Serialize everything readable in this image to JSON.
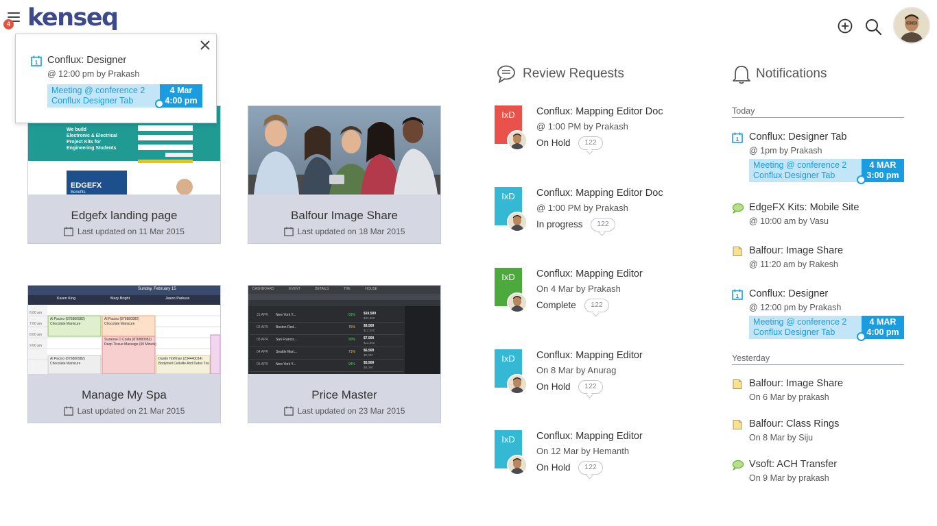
{
  "header": {
    "logo_text": "kenseq",
    "menu_badge": "4",
    "icons": [
      "add-icon",
      "search-icon"
    ]
  },
  "popup": {
    "title": "Conflux: Designer",
    "subtitle": "@ 12:00 pm by Prakash",
    "meeting_line1": "Meeting @ conference 2",
    "meeting_line2": "Conflux Designer Tab",
    "date": "4 Mar",
    "time": "4:00 pm"
  },
  "projects": [
    {
      "name": "Edgefx landing page",
      "updated": "Last updated on 11 Mar 2015",
      "thumb": {
        "l1": "We build",
        "l2": "Electronic & Electrical",
        "l3": "Project Kits for",
        "l4": "Engineering Students",
        "brand": "EDGEFX",
        "brand_sub": "Benefits"
      }
    },
    {
      "name": "Balfour Image Share",
      "updated": "Last updated on 18 Mar 2015"
    },
    {
      "name": "Manage My Spa",
      "updated": "Last updated on 21 Mar 2015",
      "thumb": {
        "date": "Sunday, February 15",
        "s1": "Karen King",
        "s2": "Mary Bright",
        "s3": "Jason Parkure",
        "a1": "Al Pacino (876880982)",
        "a1b": "Chocolate Manicure",
        "a2": "Al Pacino (876880982)",
        "a2b": "Chocolate Manicure",
        "a3": "Suzanne D Costa (876880982)",
        "a3b": "Deep Tissue Massage (90 Minute)",
        "a4": "Al Pacino (876880982)",
        "a4b": "Chocolate Manicure",
        "a5": "Dustin Hoffman (234440014)",
        "a5b": "Bodymelt Cellulite And Detox Treatment",
        "times": [
          "6:00 am",
          "7:00 am",
          "8:00 am",
          "9:00 am"
        ]
      }
    },
    {
      "name": "Price Master",
      "updated": "Last updated on 23 Mar 2015",
      "thumb": {
        "tabs": [
          "DASHBOARD",
          "EVENT DETAILS",
          "THE HOUSE"
        ],
        "rows": [
          {
            "date": "31 APR",
            "event": "New York Y...",
            "pct": "91%",
            "price": "$10,500",
            "sub": "$33,500"
          },
          {
            "date": "02 APR",
            "event": "Boston Red...",
            "pct": "75%",
            "price": "$9,500",
            "sub": "$12,000"
          },
          {
            "date": "03 APR",
            "event": "San Francis...",
            "pct": "90%",
            "price": "$7,500",
            "sub": "$13,500"
          },
          {
            "date": "04 APR",
            "event": "Seattle Mari...",
            "pct": "71%",
            "price": "$6,500",
            "sub": "$9,000"
          },
          {
            "date": "05 APR",
            "event": "New York Y...",
            "pct": "94%",
            "price": "$5,500",
            "sub": "$8,000"
          }
        ]
      }
    }
  ],
  "review_requests": {
    "title": "Review Requests",
    "items": [
      {
        "tile": "IxD",
        "color": "#e8524a",
        "title": "Conflux: Mapping Editor Doc",
        "sub": "@ 1:00 PM by Prakash",
        "status": "On Hold",
        "count": "122"
      },
      {
        "tile": "IxD",
        "color": "#35b8d3",
        "title": "Conflux: Mapping Editor Doc",
        "sub": "@ 1:00 PM by Prakash",
        "status": "In progress",
        "count": "122"
      },
      {
        "tile": "IxD",
        "color": "#4caa3c",
        "title": "Conflux: Mapping Editor",
        "sub": "On 4 Mar by Prakash",
        "status": "Complete",
        "count": "122"
      },
      {
        "tile": "IxD",
        "color": "#35b8d3",
        "title": "Conflux: Mapping Editor",
        "sub": "On 8 Mar by Anurag",
        "status": "On Hold",
        "count": "122"
      },
      {
        "tile": "IxD",
        "color": "#35b8d3",
        "title": "Conflux: Mapping Editor",
        "sub": "On 12 Mar by Hemanth",
        "status": "On Hold",
        "count": "122"
      }
    ]
  },
  "notifications": {
    "title": "Notifications",
    "today_label": "Today",
    "yesterday_label": "Yesterday",
    "today": [
      {
        "icon": "calendar-icon",
        "title": "Conflux: Designer Tab",
        "sub": "@ 1pm by Prakash",
        "meeting_line1": "Meeting @ conference 2",
        "meeting_line2": "Conflux Designer Tab",
        "date": "4 MAR",
        "time": "3:00 pm"
      },
      {
        "icon": "comment-icon",
        "title": "EdgeFX Kits: Mobile Site",
        "sub": "@ 10:00 am by Vasu"
      },
      {
        "icon": "document-icon",
        "title": "Balfour: Image Share",
        "sub": "@ 11:20 am by Rakesh"
      },
      {
        "icon": "calendar-icon",
        "title": "Conflux: Designer",
        "sub": "@ 12:00 pm by Prakash",
        "meeting_line1": "Meeting @ conference 2",
        "meeting_line2": "Conflux Designer Tab",
        "date": "4 MAR",
        "time": "4:00 pm"
      }
    ],
    "yesterday": [
      {
        "icon": "document-icon",
        "title": "Balfour: Image Share",
        "sub": "On 6 Mar by prakash"
      },
      {
        "icon": "document-icon",
        "title": "Balfour: Class Rings",
        "sub": "On 8 Mar by Siju"
      },
      {
        "icon": "comment-icon",
        "title": "Vsoft: ACH Transfer",
        "sub": "On 9 Mar by prakash"
      }
    ]
  },
  "colors": {
    "accent": "#1a9de0",
    "brand": "#3c4a8c",
    "card_bg": "#d5d8e2",
    "badge": "#e5533d"
  }
}
